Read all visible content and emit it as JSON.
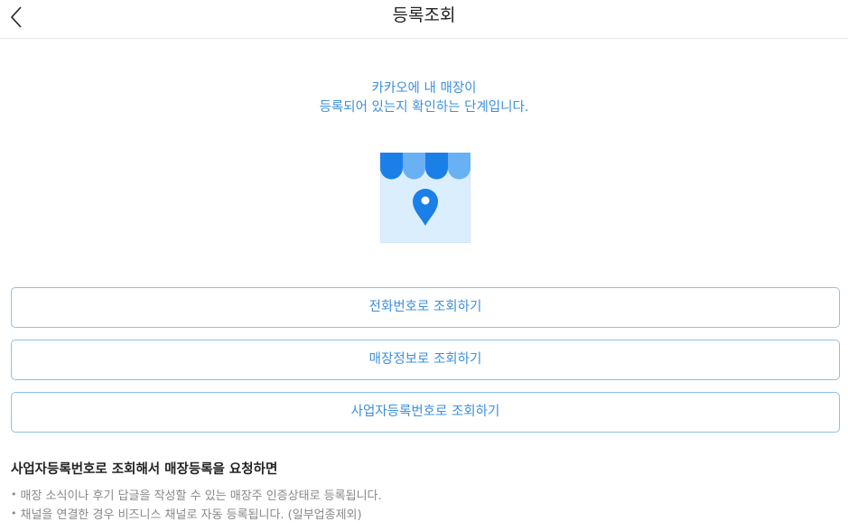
{
  "header": {
    "title": "등록조회",
    "back_icon": "chevron-left-icon"
  },
  "intro": {
    "line1": "카카오에 내 매장이",
    "line2": "등록되어 있는지 확인하는 단계입니다."
  },
  "illustration": {
    "icon": "store-location-icon",
    "colors": {
      "awning_dark": "#1b7fe8",
      "awning_light": "#6ab0f5",
      "body": "#dbeefe",
      "pin": "#1b7fe8"
    }
  },
  "options": [
    {
      "label": "전화번호로 조회하기"
    },
    {
      "label": "매장정보로 조회하기"
    },
    {
      "label": "사업자등록번호로 조회하기"
    }
  ],
  "notice": {
    "title": "사업자등록번호로 조회해서 매장등록을 요청하면",
    "bullet": "•",
    "items": [
      "매장 소식이나 후기 답글을 작성할 수 있는 매장주 인증상태로 등록됩니다.",
      "채널을 연결한 경우 비즈니스 채널로 자동 등록됩니다. (일부업종제외)"
    ]
  },
  "colors": {
    "accent": "#3d8fdc",
    "border": "#8fbfe9",
    "muted": "#888888"
  }
}
